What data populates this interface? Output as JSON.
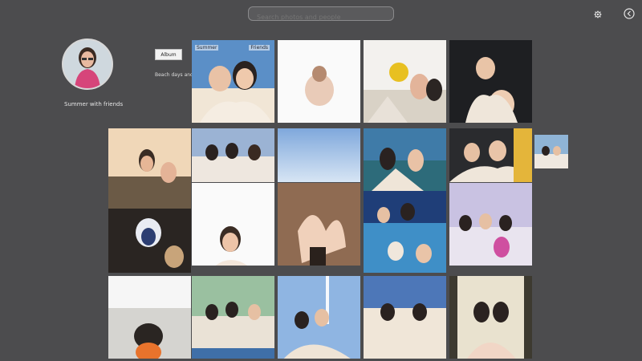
{
  "search": {
    "placeholder": "Search photos and people",
    "value": ""
  },
  "header": {
    "settings_icon": "gear-icon",
    "back_icon": "back-arrow-icon"
  },
  "profile": {
    "name": "Summer with friends",
    "tag_label": "Album",
    "caption": "Beach days and memories",
    "avatar": "profile-photo"
  },
  "tiles": [
    {
      "id": "t1",
      "kind": "beach-selfie",
      "label_left": "Summer",
      "label_right": "Friends"
    },
    {
      "id": "t2",
      "kind": "hands-sketch"
    },
    {
      "id": "t3",
      "kind": "group-boat"
    },
    {
      "id": "t4",
      "kind": "group-dark"
    },
    {
      "id": "t5",
      "kind": "sand-group"
    },
    {
      "id": "t6",
      "kind": "group-outdoor"
    },
    {
      "id": "t7",
      "kind": "sky"
    },
    {
      "id": "t8",
      "kind": "lake-pair"
    },
    {
      "id": "t9",
      "kind": "trio-tent"
    },
    {
      "id": "t10",
      "kind": "rock-shore"
    },
    {
      "id": "t11",
      "kind": "pair-white"
    },
    {
      "id": "t12",
      "kind": "hands-heart"
    },
    {
      "id": "t13",
      "kind": "group-blue"
    },
    {
      "id": "t14",
      "kind": "group-lavender"
    },
    {
      "id": "t15",
      "kind": "boat-sea"
    },
    {
      "id": "t16",
      "kind": "group-green"
    },
    {
      "id": "t17",
      "kind": "group-sky"
    },
    {
      "id": "t18",
      "kind": "group-sunset"
    },
    {
      "id": "t19",
      "kind": "pair-forest"
    }
  ],
  "side_thumb": {
    "kind": "group-small"
  }
}
